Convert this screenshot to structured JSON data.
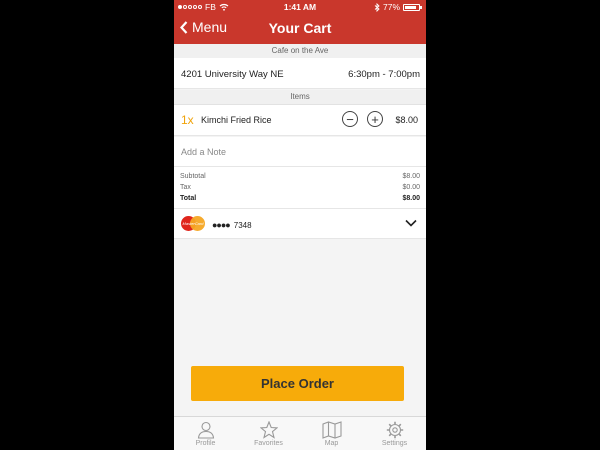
{
  "status": {
    "carrier": "FB",
    "time": "1:41 AM",
    "battery": "77%"
  },
  "nav": {
    "back_label": "Menu",
    "title": "Your Cart"
  },
  "restaurant": "Cafe on the Ave",
  "address": {
    "street": "4201 University Way NE",
    "time_window": "6:30pm - 7:00pm"
  },
  "items_header": "Items",
  "items": [
    {
      "qty": "1x",
      "name": "Kimchi Fried Rice",
      "price": "$8.00"
    }
  ],
  "note_placeholder": "Add a Note",
  "totals": {
    "subtotal_label": "Subtotal",
    "subtotal": "$8.00",
    "tax_label": "Tax",
    "tax": "$0.00",
    "total_label": "Total",
    "total": "$8.00"
  },
  "payment": {
    "brand_text": "MasterCard",
    "masked": "●●●●",
    "last4": "7348"
  },
  "place_order_label": "Place Order",
  "tabs": [
    {
      "label": "Profile",
      "icon": "person-icon"
    },
    {
      "label": "Favorites",
      "icon": "star-icon"
    },
    {
      "label": "Map",
      "icon": "map-icon"
    },
    {
      "label": "Settings",
      "icon": "gear-icon"
    }
  ],
  "colors": {
    "brand": "#c9372c",
    "accent": "#f7ab0a"
  }
}
